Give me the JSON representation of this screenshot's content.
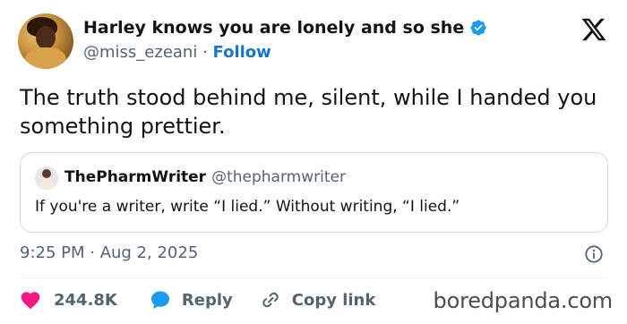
{
  "author": {
    "display_name": "Harley knows you are lonely and so she",
    "handle": "@miss_ezeani",
    "separator": "·",
    "follow_label": "Follow",
    "verified": true
  },
  "tweet": {
    "text": "The truth stood behind me, silent, while I handed you something prettier."
  },
  "quote": {
    "name": "ThePharmWriter",
    "handle": "@thepharmwriter",
    "text": "If you're a writer, write “I lied.” Without writing, “I lied.”"
  },
  "timestamp": "9:25 PM · Aug 2, 2025",
  "actions": {
    "likes_count": "244.8K",
    "reply_label": "Reply",
    "copy_link_label": "Copy link"
  },
  "watermark": "boredpanda.com",
  "colors": {
    "verified_blue": "#1d9bf0",
    "follow_blue": "#1d73c4",
    "like_pink": "#f91880",
    "reply_blue": "#1d9bf0",
    "secondary_text": "#536471"
  },
  "icons": [
    "verified-badge-icon",
    "x-logo-icon",
    "info-icon",
    "heart-icon",
    "reply-bubble-icon",
    "link-icon"
  ]
}
